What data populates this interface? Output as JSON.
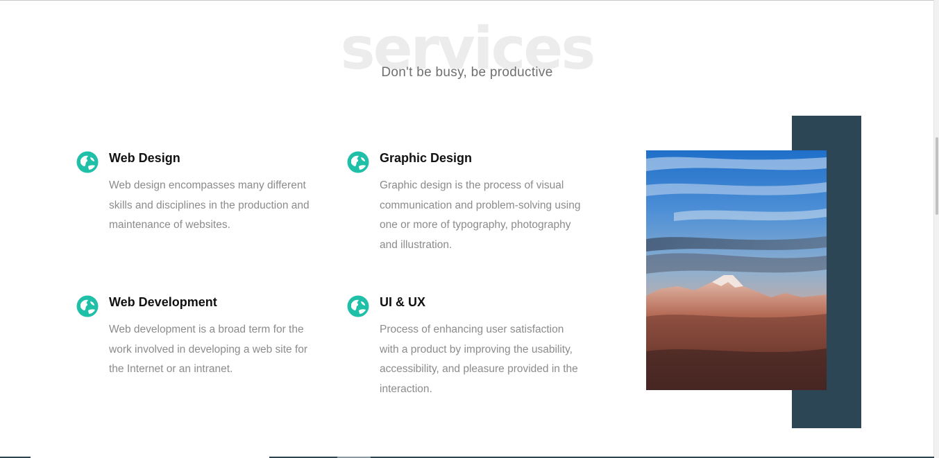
{
  "section": {
    "watermark": "services",
    "subtitle": "Don't be busy, be productive"
  },
  "services": [
    {
      "title": "Web Design",
      "description": "Web design encompasses many different skills and disciplines in the production and maintenance of websites.",
      "icon": "globe-icon"
    },
    {
      "title": "Graphic Design",
      "description": "Graphic design is the process of visual communication and problem-solving using one or more of typography, photography and illustration.",
      "icon": "globe-icon"
    },
    {
      "title": "Web Development",
      "description": "Web development is a broad term for the work involved in developing a web site for the Internet or an intranet.",
      "icon": "globe-icon"
    },
    {
      "title": "UI & UX",
      "description": "Process of enhancing user satisfaction with a product by improving the usability, accessibility, and pleasure provided in the interaction.",
      "icon": "globe-icon"
    }
  ],
  "colors": {
    "accent": "#1fbfa8",
    "dark_panel": "#2c4655",
    "watermark": "#ececec",
    "subtitle": "#6f6f6f",
    "body_text": "#8b8b8b"
  },
  "image": {
    "subject": "mountain-landscape-photo"
  }
}
